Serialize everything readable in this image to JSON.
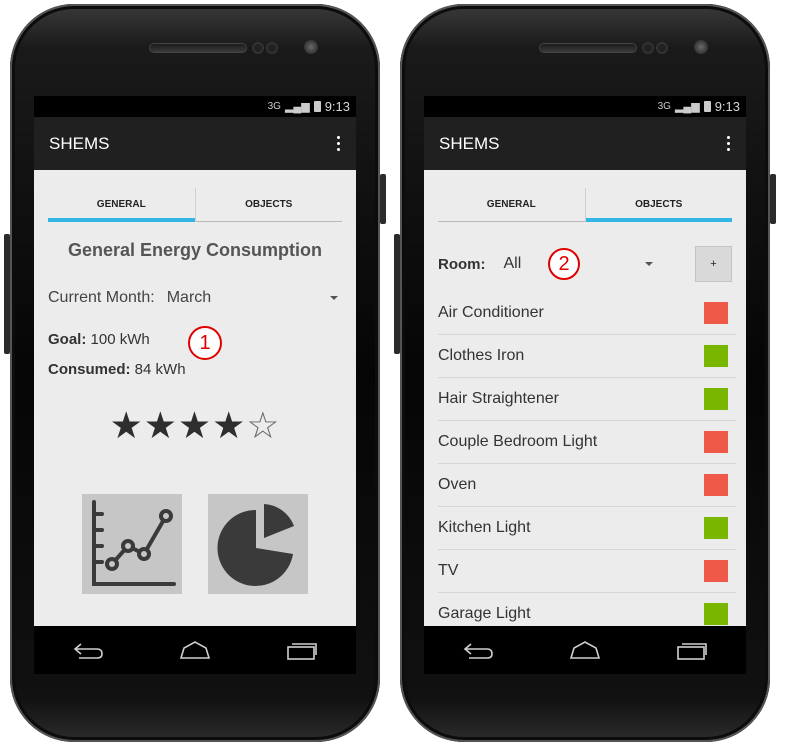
{
  "left_phone": {
    "status": {
      "network": "3G",
      "time": "9:13"
    },
    "app_title": "SHEMS",
    "tabs": [
      {
        "label": "GENERAL",
        "active": true
      },
      {
        "label": "OBJECTS",
        "active": false
      }
    ],
    "heading": "General Energy Consumption",
    "month_label": "Current Month:",
    "month_value": "March",
    "goal_label": "Goal:",
    "goal_value": "100",
    "goal_unit": "kWh",
    "consumed_label": "Consumed:",
    "consumed_value": "84",
    "consumed_unit": "kWh",
    "rating": {
      "value": 4,
      "max": 5
    },
    "icons": [
      "line-chart-icon",
      "pie-chart-icon"
    ],
    "annotation": "1"
  },
  "right_phone": {
    "status": {
      "network": "3G",
      "time": "9:13"
    },
    "app_title": "SHEMS",
    "tabs": [
      {
        "label": "GENERAL",
        "active": false
      },
      {
        "label": "OBJECTS",
        "active": true
      }
    ],
    "room_label": "Room:",
    "room_value": "All",
    "add_label": "+",
    "annotation": "2",
    "objects": [
      {
        "name": "Air Conditioner",
        "color": "#ee5a47"
      },
      {
        "name": "Clothes Iron",
        "color": "#78b600"
      },
      {
        "name": "Hair Straightener",
        "color": "#78b600"
      },
      {
        "name": "Couple Bedroom Light",
        "color": "#ee5a47"
      },
      {
        "name": "Oven",
        "color": "#ee5a47"
      },
      {
        "name": "Kitchen Light",
        "color": "#78b600"
      },
      {
        "name": "TV",
        "color": "#ee5a47"
      },
      {
        "name": "Garage Light",
        "color": "#78b600"
      }
    ]
  },
  "colors": {
    "tab_indicator": "#33b5e5",
    "off_status": "#ee5a47",
    "on_status": "#78b600",
    "annotation": "#e00000"
  }
}
